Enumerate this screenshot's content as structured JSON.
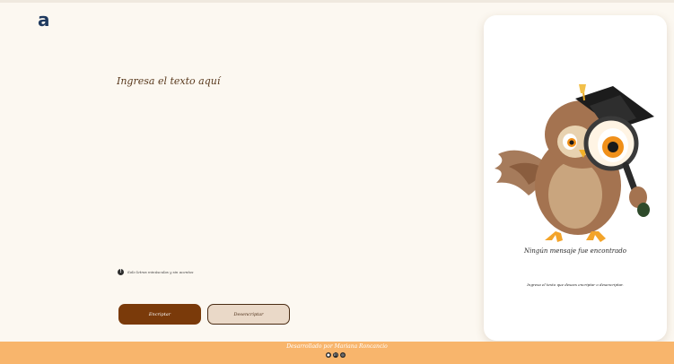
{
  "app": {
    "logo_text": "a"
  },
  "editor": {
    "placeholder": "Ingresa el texto aquí"
  },
  "hint": {
    "icon": "info-icon",
    "text": "Solo letras minúsculas y sin acentos"
  },
  "buttons": {
    "encrypt_label": "Encriptar",
    "decrypt_label": "Desencriptar"
  },
  "result_panel": {
    "image": "owl-with-magnifier",
    "title": "Ningún mensaje fue encontrado",
    "subtitle": "Ingresa el texto que desees encriptar o desencriptar."
  },
  "footer": {
    "credit": "Desarrollado por Mariana Roncancio",
    "icons": [
      "github-icon",
      "linkedin-icon",
      "instagram-icon"
    ]
  },
  "colors": {
    "background": "#fcf8f1",
    "primary": "#7a3a0a",
    "secondary": "#ead9c8",
    "footer": "#f8b56c"
  }
}
